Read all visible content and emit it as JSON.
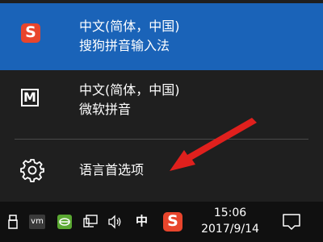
{
  "ime_menu": {
    "items": [
      {
        "language": "中文(简体，中国)",
        "name": "搜狗拼音输入法",
        "icon": "sogou-icon",
        "icon_glyph": "S",
        "selected": true
      },
      {
        "language": "中文(简体，中国)",
        "name": "微软拼音",
        "icon": "microsoft-pinyin-icon",
        "icon_glyph": "M",
        "selected": false
      }
    ],
    "language_preferences": {
      "label": "语言首选项",
      "icon": "gear-icon"
    }
  },
  "taskbar": {
    "ime_mode": "中",
    "tray_sogou_glyph": "S",
    "tray_vm_glyph": "vm",
    "clock": {
      "time": "15:06",
      "date": "2017/9/14"
    }
  },
  "colors": {
    "selected_bg": "#1a63b8",
    "flyout_bg": "#1f1f1f",
    "taskbar_bg": "#101010",
    "annotation_arrow": "#e0201d",
    "sogou_red": "#e8452c"
  }
}
